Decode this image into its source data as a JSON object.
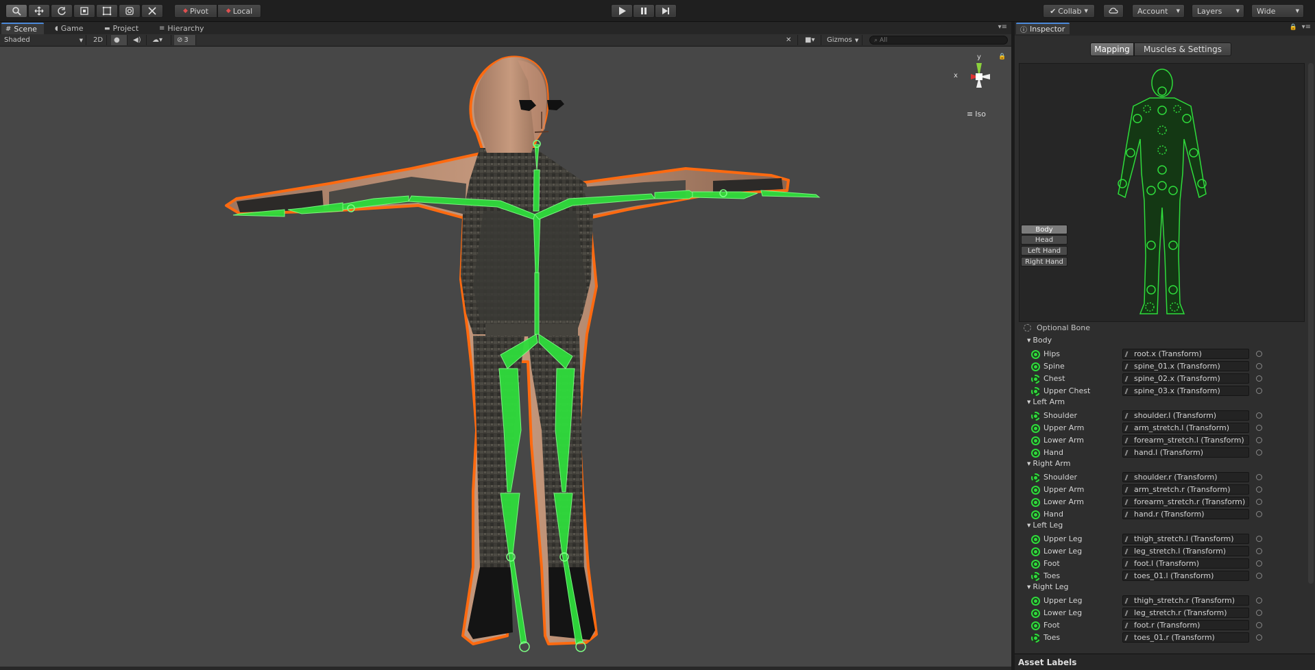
{
  "toolbar": {
    "pivot_label": "Pivot",
    "local_label": "Local",
    "collab_label": "Collab",
    "account_label": "Account",
    "layers_label": "Layers",
    "layout_label": "Wide"
  },
  "tabs": {
    "scene": "Scene",
    "game": "Game",
    "project": "Project",
    "hierarchy": "Hierarchy"
  },
  "scene_bar": {
    "draw_mode": "Shaded",
    "mode_2d": "2D",
    "hidden_count": "3",
    "gizmos_label": "Gizmos",
    "search_placeholder": "All"
  },
  "viewport": {
    "gizmo_y": "y",
    "gizmo_x": "x",
    "projection": "Iso"
  },
  "inspector": {
    "tab_label": "Inspector",
    "mapping_tab": "Mapping",
    "muscles_tab": "Muscles & Settings",
    "body_parts": [
      "Body",
      "Head",
      "Left Hand",
      "Right Hand"
    ],
    "optional_bone_label": "Optional Bone",
    "groups": [
      {
        "name": "Body",
        "bones": [
          {
            "label": "Hips",
            "value": "root.x (Transform)",
            "optional": false
          },
          {
            "label": "Spine",
            "value": "spine_01.x (Transform)",
            "optional": false
          },
          {
            "label": "Chest",
            "value": "spine_02.x (Transform)",
            "optional": true
          },
          {
            "label": "Upper Chest",
            "value": "spine_03.x (Transform)",
            "optional": true
          }
        ]
      },
      {
        "name": "Left Arm",
        "bones": [
          {
            "label": "Shoulder",
            "value": "shoulder.l (Transform)",
            "optional": true
          },
          {
            "label": "Upper Arm",
            "value": "arm_stretch.l (Transform)",
            "optional": false
          },
          {
            "label": "Lower Arm",
            "value": "forearm_stretch.l (Transform)",
            "optional": false
          },
          {
            "label": "Hand",
            "value": "hand.l (Transform)",
            "optional": false
          }
        ]
      },
      {
        "name": "Right Arm",
        "bones": [
          {
            "label": "Shoulder",
            "value": "shoulder.r (Transform)",
            "optional": true
          },
          {
            "label": "Upper Arm",
            "value": "arm_stretch.r (Transform)",
            "optional": false
          },
          {
            "label": "Lower Arm",
            "value": "forearm_stretch.r (Transform)",
            "optional": false
          },
          {
            "label": "Hand",
            "value": "hand.r (Transform)",
            "optional": false
          }
        ]
      },
      {
        "name": "Left Leg",
        "bones": [
          {
            "label": "Upper Leg",
            "value": "thigh_stretch.l (Transform)",
            "optional": false
          },
          {
            "label": "Lower Leg",
            "value": "leg_stretch.l (Transform)",
            "optional": false
          },
          {
            "label": "Foot",
            "value": "foot.l (Transform)",
            "optional": false
          },
          {
            "label": "Toes",
            "value": "toes_01.l (Transform)",
            "optional": true
          }
        ]
      },
      {
        "name": "Right Leg",
        "bones": [
          {
            "label": "Upper Leg",
            "value": "thigh_stretch.r (Transform)",
            "optional": false
          },
          {
            "label": "Lower Leg",
            "value": "leg_stretch.r (Transform)",
            "optional": false
          },
          {
            "label": "Foot",
            "value": "foot.r (Transform)",
            "optional": false
          },
          {
            "label": "Toes",
            "value": "toes_01.r (Transform)",
            "optional": true
          }
        ]
      }
    ],
    "asset_labels": "Asset Labels"
  },
  "colors": {
    "accent": "#4a88d8",
    "bone_green": "#2fdc3c",
    "outline_orange": "#ff6a10"
  }
}
